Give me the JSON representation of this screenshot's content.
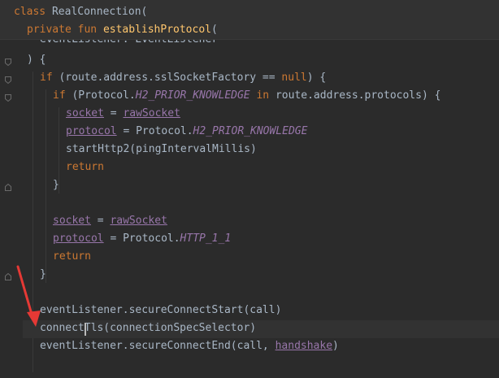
{
  "sticky": {
    "line1": {
      "kw_class": "class",
      "name": "RealConnection("
    },
    "line2": {
      "kw_private": "private",
      "kw_fun": "fun",
      "fn_name": "establishProtocol",
      "paren": "("
    },
    "line3_partial": "eventListener: EventListener"
  },
  "code": {
    "l_close_paren": ") {",
    "l_if1": {
      "kw": "if",
      "expr": " (route.address.sslSocketFactory == ",
      "kw_null": "null",
      "tail": ") {"
    },
    "l_if2": {
      "kw": "if",
      "pre": " (Protocol.",
      "const": "H2_PRIOR_KNOWLEDGE",
      "kw_in": "in",
      "tail": " route.address.protocols) {"
    },
    "l_socket1": {
      "prop": "socket",
      "eq": " = ",
      "val": "rawSocket"
    },
    "l_protocol1": {
      "prop": "protocol",
      "eq": " = Protocol.",
      "const": "H2_PRIOR_KNOWLEDGE"
    },
    "l_start": "startHttp2(pingIntervalMillis)",
    "l_return1": "return",
    "l_brace1": "}",
    "l_socket2": {
      "prop": "socket",
      "eq": " = ",
      "val": "rawSocket"
    },
    "l_protocol2": {
      "prop": "protocol",
      "eq": " = Protocol.",
      "const": "HTTP_1_1"
    },
    "l_return2": "return",
    "l_brace2": "}",
    "l_secure_start": "eventListener.secureConnectStart(call)",
    "l_connect_tls": "connectTls(connectionSpecSelector)",
    "l_secure_end": {
      "pre": "eventListener.secureConnectEnd(call, ",
      "prop": "handshake",
      "tail": ")"
    }
  },
  "colors": {
    "background": "#2b2b2b",
    "keyword": "#cc7832",
    "function": "#ffc66d",
    "property": "#9876aa",
    "text": "#a9b7c6",
    "arrow": "#e53935"
  },
  "icons": [
    "fold-marker-icon",
    "red-arrow-annotation"
  ]
}
